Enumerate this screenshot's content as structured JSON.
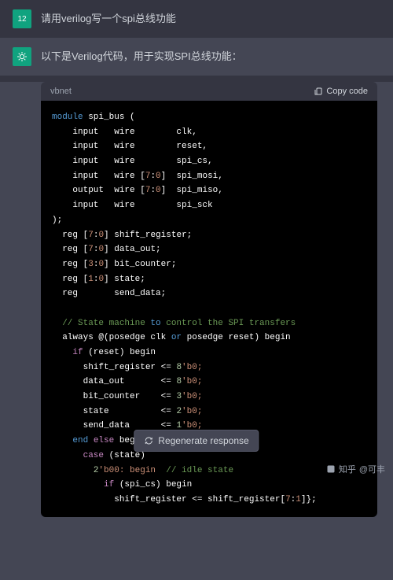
{
  "user_msg": {
    "avatar": "12",
    "text": "请用verilog写一个spi总线功能"
  },
  "assistant_msg": {
    "intro": "以下是Verilog代码，用于实现SPI总线功能："
  },
  "code_header": {
    "lang": "vbnet",
    "copy_label": "Copy code"
  },
  "code_lines": [
    {
      "t": "module",
      "c": "k-blue"
    },
    {
      "t": " spi_bus (",
      "c": ""
    },
    {
      "br": 1
    },
    {
      "t": "    input   wire        clk,",
      "c": ""
    },
    {
      "br": 1
    },
    {
      "t": "    input   wire        reset,",
      "c": ""
    },
    {
      "br": 1
    },
    {
      "t": "    input   wire        spi_cs,",
      "c": ""
    },
    {
      "br": 1
    },
    {
      "t": "    input   wire [",
      "c": ""
    },
    {
      "t": "7",
      "c": "k-orange"
    },
    {
      "t": ":",
      "c": ""
    },
    {
      "t": "0",
      "c": "k-orange"
    },
    {
      "t": "]  spi_mosi,",
      "c": ""
    },
    {
      "br": 1
    },
    {
      "t": "    output  wire [",
      "c": ""
    },
    {
      "t": "7",
      "c": "k-orange"
    },
    {
      "t": ":",
      "c": ""
    },
    {
      "t": "0",
      "c": "k-orange"
    },
    {
      "t": "]  spi_miso,",
      "c": ""
    },
    {
      "br": 1
    },
    {
      "t": "    input   wire        spi_sck",
      "c": ""
    },
    {
      "br": 1
    },
    {
      "t": ");",
      "c": ""
    },
    {
      "br": 1
    },
    {
      "t": "  reg [",
      "c": ""
    },
    {
      "t": "7",
      "c": "k-orange"
    },
    {
      "t": ":",
      "c": ""
    },
    {
      "t": "0",
      "c": "k-orange"
    },
    {
      "t": "] shift_register;",
      "c": ""
    },
    {
      "br": 1
    },
    {
      "t": "  reg [",
      "c": ""
    },
    {
      "t": "7",
      "c": "k-orange"
    },
    {
      "t": ":",
      "c": ""
    },
    {
      "t": "0",
      "c": "k-orange"
    },
    {
      "t": "] data_out;",
      "c": ""
    },
    {
      "br": 1
    },
    {
      "t": "  reg [",
      "c": ""
    },
    {
      "t": "3",
      "c": "k-orange"
    },
    {
      "t": ":",
      "c": ""
    },
    {
      "t": "0",
      "c": "k-orange"
    },
    {
      "t": "] bit_counter;",
      "c": ""
    },
    {
      "br": 1
    },
    {
      "t": "  reg [",
      "c": ""
    },
    {
      "t": "1",
      "c": "k-orange"
    },
    {
      "t": ":",
      "c": ""
    },
    {
      "t": "0",
      "c": "k-orange"
    },
    {
      "t": "] state;",
      "c": ""
    },
    {
      "br": 1
    },
    {
      "t": "  reg       send_data;",
      "c": ""
    },
    {
      "br": 1
    },
    {
      "br": 1
    },
    {
      "t": "  // State machine ",
      "c": "k-comment"
    },
    {
      "t": "to",
      "c": "k-blue"
    },
    {
      "t": " control the SPI transfers",
      "c": "k-comment"
    },
    {
      "br": 1
    },
    {
      "t": "  always @(posedge clk ",
      "c": ""
    },
    {
      "t": "or",
      "c": "k-blue"
    },
    {
      "t": " posedge reset) begin",
      "c": ""
    },
    {
      "br": 1
    },
    {
      "t": "    ",
      "c": ""
    },
    {
      "t": "if",
      "c": "k-pink"
    },
    {
      "t": " (reset) begin",
      "c": ""
    },
    {
      "br": 1
    },
    {
      "t": "      shift_register <= ",
      "c": ""
    },
    {
      "t": "8",
      "c": "k-num"
    },
    {
      "t": "'b0;",
      "c": "k-orange"
    },
    {
      "br": 1
    },
    {
      "t": "      data_out       <= ",
      "c": ""
    },
    {
      "t": "8",
      "c": "k-num"
    },
    {
      "t": "'b0;",
      "c": "k-orange"
    },
    {
      "br": 1
    },
    {
      "t": "      bit_counter    <= ",
      "c": ""
    },
    {
      "t": "3",
      "c": "k-num"
    },
    {
      "t": "'b0;",
      "c": "k-orange"
    },
    {
      "br": 1
    },
    {
      "t": "      state          <= ",
      "c": ""
    },
    {
      "t": "2",
      "c": "k-num"
    },
    {
      "t": "'b0;",
      "c": "k-orange"
    },
    {
      "br": 1
    },
    {
      "t": "      send_data      <= ",
      "c": ""
    },
    {
      "t": "1",
      "c": "k-num"
    },
    {
      "t": "'b0;",
      "c": "k-orange"
    },
    {
      "br": 1
    },
    {
      "t": "    ",
      "c": ""
    },
    {
      "t": "end",
      "c": "k-blue"
    },
    {
      "t": " ",
      "c": ""
    },
    {
      "t": "else",
      "c": "k-pink"
    },
    {
      "t": " begin",
      "c": ""
    },
    {
      "br": 1
    },
    {
      "t": "      ",
      "c": ""
    },
    {
      "t": "case",
      "c": "k-pink"
    },
    {
      "t": " (state)",
      "c": ""
    },
    {
      "br": 1
    },
    {
      "t": "        ",
      "c": ""
    },
    {
      "t": "2",
      "c": "k-num"
    },
    {
      "t": "'b00: begin  ",
      "c": "k-orange"
    },
    {
      "t": "// idle state",
      "c": "k-comment"
    },
    {
      "br": 1
    },
    {
      "t": "          ",
      "c": ""
    },
    {
      "t": "if",
      "c": "k-pink"
    },
    {
      "t": " (spi_cs) begin",
      "c": ""
    },
    {
      "br": 1
    },
    {
      "t": "            shift_register <= shift_register[",
      "c": ""
    },
    {
      "t": "7",
      "c": "k-orange"
    },
    {
      "t": ":",
      "c": ""
    },
    {
      "t": "1",
      "c": "k-orange"
    },
    {
      "t": "]};",
      "c": ""
    },
    {
      "br": 1
    }
  ],
  "regen_label": "Regenerate response",
  "attribution": {
    "site": "知乎",
    "author": "@可丰"
  }
}
